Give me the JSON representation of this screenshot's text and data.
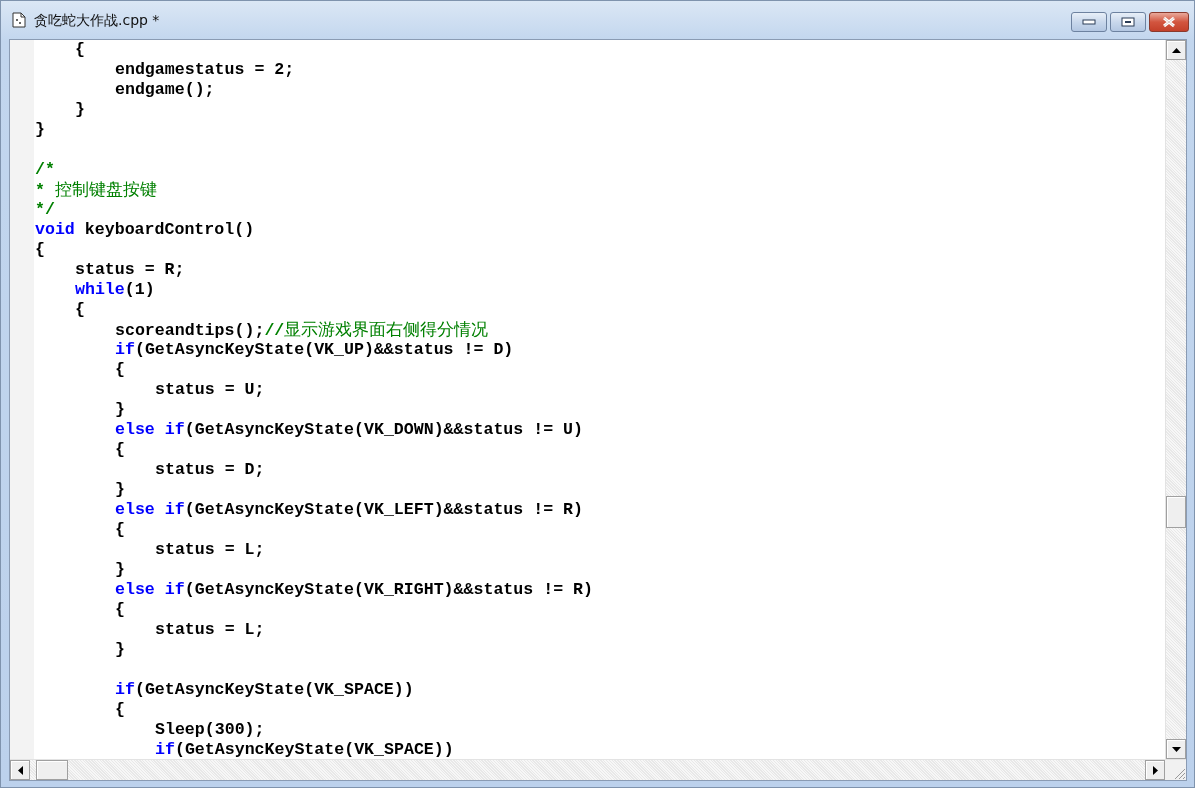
{
  "window": {
    "title": "贪吃蛇大作战.cpp *"
  },
  "editor": {
    "lines": [
      {
        "children": [
          {
            "tokens": [
              {
                "kind": "code",
                "text": "{"
              }
            ]
          },
          {
            "children": [
              {
                "tokens": [
                  {
                    "kind": "code",
                    "text": "endgamestatus = 2;"
                  }
                ]
              },
              {
                "tokens": [
                  {
                    "kind": "code",
                    "text": "endgame();"
                  }
                ]
              }
            ]
          },
          {
            "tokens": [
              {
                "kind": "code",
                "text": "}"
              }
            ]
          }
        ]
      },
      {
        "tokens": [
          {
            "kind": "code",
            "text": "}"
          }
        ]
      },
      {
        "kind": "blank"
      },
      {
        "tokens": [
          {
            "kind": "comment",
            "text": "/*"
          }
        ]
      },
      {
        "tokens": [
          {
            "kind": "comment",
            "text": "* 控制键盘按键"
          }
        ]
      },
      {
        "tokens": [
          {
            "kind": "comment",
            "text": "*/"
          }
        ]
      },
      {
        "tokens": [
          {
            "kind": "keyword",
            "text": "void"
          },
          {
            "kind": "code",
            "text": " keyboardControl()"
          }
        ]
      },
      {
        "tokens": [
          {
            "kind": "code",
            "text": "{"
          }
        ]
      },
      {
        "children": [
          {
            "tokens": [
              {
                "kind": "code",
                "text": "status = R;"
              }
            ]
          },
          {
            "tokens": [
              {
                "kind": "keyword",
                "text": "while"
              },
              {
                "kind": "code",
                "text": "(1)"
              }
            ]
          },
          {
            "tokens": [
              {
                "kind": "code",
                "text": "{"
              }
            ]
          },
          {
            "children": [
              {
                "tokens": [
                  {
                    "kind": "code",
                    "text": "scoreandtips();"
                  },
                  {
                    "kind": "comment",
                    "text": "//显示游戏界面右侧得分情况"
                  }
                ]
              },
              {
                "tokens": [
                  {
                    "kind": "keyword",
                    "text": "if"
                  },
                  {
                    "kind": "code",
                    "text": "(GetAsyncKeyState(VK_UP)&&status != D)"
                  }
                ]
              },
              {
                "tokens": [
                  {
                    "kind": "code",
                    "text": "{"
                  }
                ]
              },
              {
                "children": [
                  {
                    "tokens": [
                      {
                        "kind": "code",
                        "text": "status = U;"
                      }
                    ]
                  }
                ]
              },
              {
                "tokens": [
                  {
                    "kind": "code",
                    "text": "}"
                  }
                ]
              },
              {
                "tokens": [
                  {
                    "kind": "keyword",
                    "text": "else if"
                  },
                  {
                    "kind": "code",
                    "text": "(GetAsyncKeyState(VK_DOWN)&&status != U)"
                  }
                ]
              },
              {
                "tokens": [
                  {
                    "kind": "code",
                    "text": "{"
                  }
                ]
              },
              {
                "children": [
                  {
                    "tokens": [
                      {
                        "kind": "code",
                        "text": "status = D;"
                      }
                    ]
                  }
                ]
              },
              {
                "tokens": [
                  {
                    "kind": "code",
                    "text": "}"
                  }
                ]
              },
              {
                "tokens": [
                  {
                    "kind": "keyword",
                    "text": "else if"
                  },
                  {
                    "kind": "code",
                    "text": "(GetAsyncKeyState(VK_LEFT)&&status != R)"
                  }
                ]
              },
              {
                "tokens": [
                  {
                    "kind": "code",
                    "text": "{"
                  }
                ]
              },
              {
                "children": [
                  {
                    "tokens": [
                      {
                        "kind": "code",
                        "text": "status = L;"
                      }
                    ]
                  }
                ]
              },
              {
                "tokens": [
                  {
                    "kind": "code",
                    "text": "}"
                  }
                ]
              },
              {
                "tokens": [
                  {
                    "kind": "keyword",
                    "text": "else if"
                  },
                  {
                    "kind": "code",
                    "text": "(GetAsyncKeyState(VK_RIGHT)&&status != R)"
                  }
                ]
              },
              {
                "tokens": [
                  {
                    "kind": "code",
                    "text": "{"
                  }
                ]
              },
              {
                "children": [
                  {
                    "tokens": [
                      {
                        "kind": "code",
                        "text": "status = L;"
                      }
                    ]
                  }
                ]
              },
              {
                "tokens": [
                  {
                    "kind": "code",
                    "text": "}"
                  }
                ]
              },
              {
                "kind": "blank"
              },
              {
                "tokens": [
                  {
                    "kind": "keyword",
                    "text": "if"
                  },
                  {
                    "kind": "code",
                    "text": "(GetAsyncKeyState(VK_SPACE))"
                  }
                ]
              },
              {
                "tokens": [
                  {
                    "kind": "code",
                    "text": "{"
                  }
                ]
              },
              {
                "children": [
                  {
                    "tokens": [
                      {
                        "kind": "code",
                        "text": "Sleep(300);"
                      }
                    ]
                  },
                  {
                    "tokens": [
                      {
                        "kind": "keyword",
                        "text": "if"
                      },
                      {
                        "kind": "code",
                        "text": "(GetAsyncKeyState(VK_SPACE))"
                      }
                    ]
                  }
                ]
              }
            ]
          }
        ]
      }
    ]
  }
}
